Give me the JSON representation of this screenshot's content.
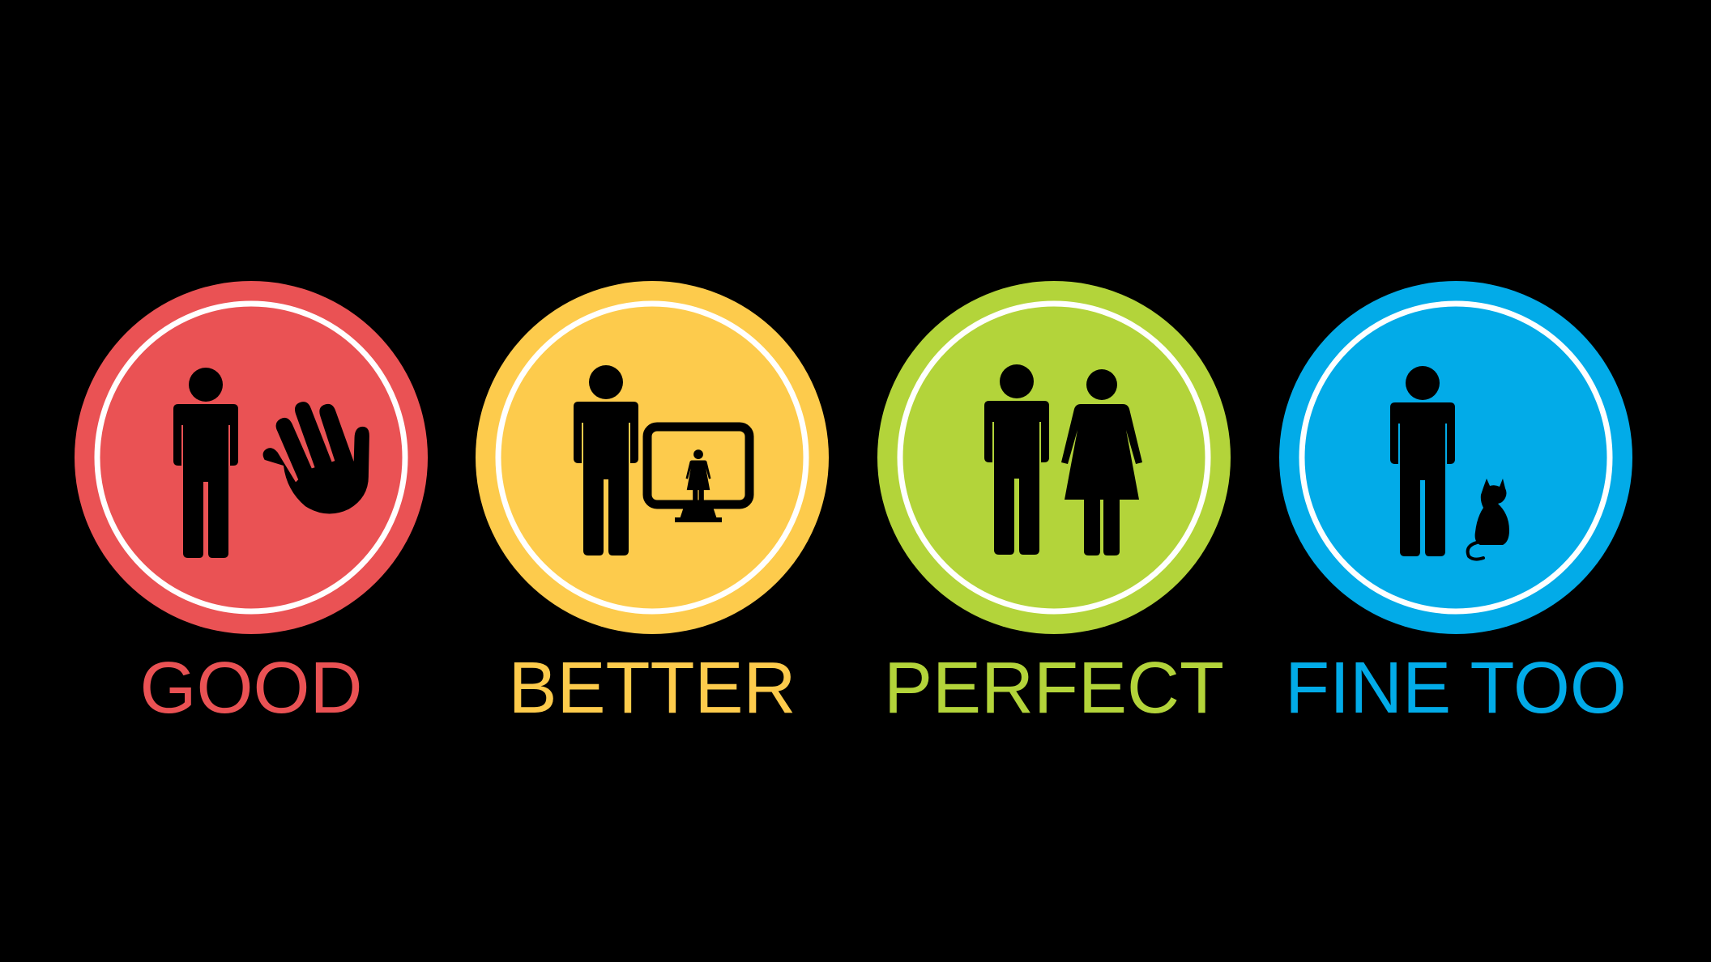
{
  "badges": [
    {
      "label": "GOOD",
      "color": "#ea5254",
      "icons": [
        "man-icon",
        "hand-icon"
      ]
    },
    {
      "label": "BETTER",
      "color": "#fdcb4c",
      "icons": [
        "man-icon",
        "monitor-icon",
        "woman-icon"
      ]
    },
    {
      "label": "PERFECT",
      "color": "#b3d43a",
      "icons": [
        "man-icon",
        "woman-icon"
      ]
    },
    {
      "label": "FINE TOO",
      "color": "#02abe8",
      "icons": [
        "man-icon",
        "cat-icon"
      ]
    }
  ],
  "ring_color": "#ffffff",
  "figure_color": "#000000",
  "background": "#000000"
}
